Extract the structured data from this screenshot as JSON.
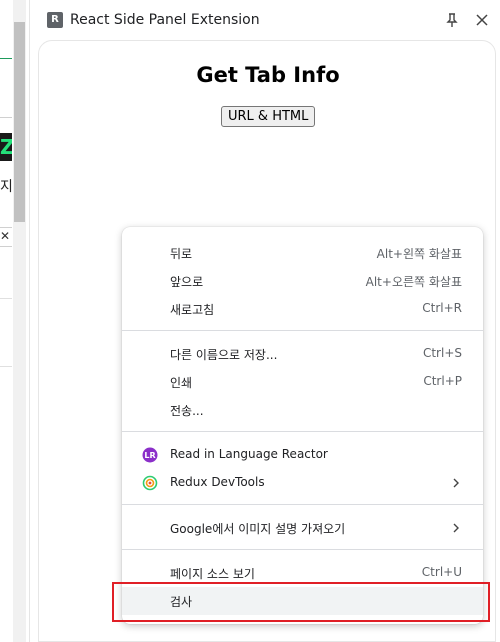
{
  "left_page": {
    "partial_char": "지",
    "close_glyph": "✕",
    "logo_glyph": "Z",
    "logo_color": "#24e07a"
  },
  "side_panel": {
    "logo_letter": "R",
    "title": "React Side Panel Extension",
    "pin_icon": "pin-icon",
    "close_icon": "close-icon"
  },
  "content": {
    "heading": "Get Tab Info",
    "button_label": "URL & HTML"
  },
  "context_menu": {
    "items": [
      {
        "label": "뒤로",
        "shortcut": "Alt+왼쪽 화살표"
      },
      {
        "label": "앞으로",
        "shortcut": "Alt+오른쪽 화살표"
      },
      {
        "label": "새로고침",
        "shortcut": "Ctrl+R"
      },
      {
        "label": "다른 이름으로 저장...",
        "shortcut": "Ctrl+S"
      },
      {
        "label": "인쇄",
        "shortcut": "Ctrl+P"
      },
      {
        "label": "전송...",
        "shortcut": ""
      },
      {
        "label": "Read in Language Reactor",
        "shortcut": "",
        "icon": "language-reactor-icon"
      },
      {
        "label": "Redux DevTools",
        "shortcut": "",
        "icon": "redux-devtools-icon",
        "submenu": true
      },
      {
        "label": "Google에서 이미지 설명 가져오기",
        "shortcut": "",
        "submenu": true
      },
      {
        "label": "페이지 소스 보기",
        "shortcut": "Ctrl+U"
      },
      {
        "label": "검사",
        "shortcut": "",
        "highlighted": true
      }
    ],
    "highlight_color": "#e01f26"
  }
}
